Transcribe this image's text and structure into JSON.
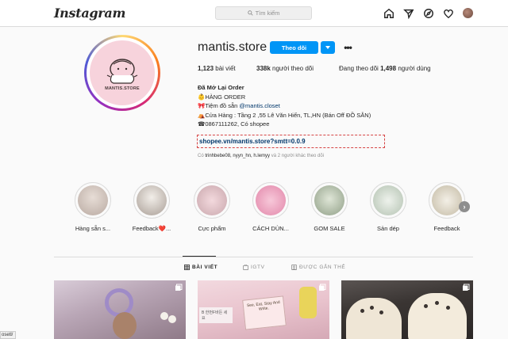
{
  "nav": {
    "logo": "Instagram",
    "search_placeholder": "Tìm kiếm"
  },
  "profile": {
    "username": "mantis.store",
    "follow_label": "Theo dõi",
    "more_label": "•••",
    "pic_text": "MANTIS.STORE",
    "stats": [
      {
        "value": "1,123",
        "label": "bài viết"
      },
      {
        "value": "338k",
        "label": "người theo dõi"
      },
      {
        "prefix": "Đang theo dõi",
        "value": "1,498",
        "label": "người dùng"
      }
    ],
    "bio": {
      "name": "Đã Mở Lại Order",
      "lines": [
        "👶HÀNG ORDER",
        "🎀Tiệm đồ sẵn ",
        "⛺Cửa Hàng : Tầng 2 ,55 Lê Văn Hiến, TL,HN (Bán Off ĐỒ SẴN)",
        "☎0867111262, Có shopee"
      ],
      "mention": "@mantis.closet",
      "link": "shopee.vn/mantis.store?smtt=0.0.9"
    },
    "followed_by": {
      "prefix": "Có",
      "names": "trinhbebe08, nyyn_hn, h.lemyy",
      "suffix": "và 2 người khác theo dõi"
    }
  },
  "highlights": [
    {
      "label": "Hàng sẵn s..."
    },
    {
      "label": "Feedback❤️..."
    },
    {
      "label": "Cực phẩm"
    },
    {
      "label": "CÁCH DÙN..."
    },
    {
      "label": "GOM SALE"
    },
    {
      "label": "Sản dép"
    },
    {
      "label": "Feedback"
    }
  ],
  "highlight_next": "›",
  "tabs": [
    {
      "label": "BÀI VIẾT",
      "active": true
    },
    {
      "label": "IGTV",
      "active": false
    },
    {
      "label": "ĐƯỢC GẮN THẺ",
      "active": false
    }
  ],
  "posts": [
    {
      "alt": "post-1"
    },
    {
      "caption_sign": "See, Eat, Stay And Write.",
      "caption_cards": "B 한번F바든 세요"
    },
    {
      "alt": "post-3"
    }
  ],
  "status_bar": "osetl/",
  "colors": {
    "follow_blue": "#0095f6",
    "link_blue": "#00376b",
    "border": "#dbdbdb",
    "muted": "#8e8e8e"
  }
}
